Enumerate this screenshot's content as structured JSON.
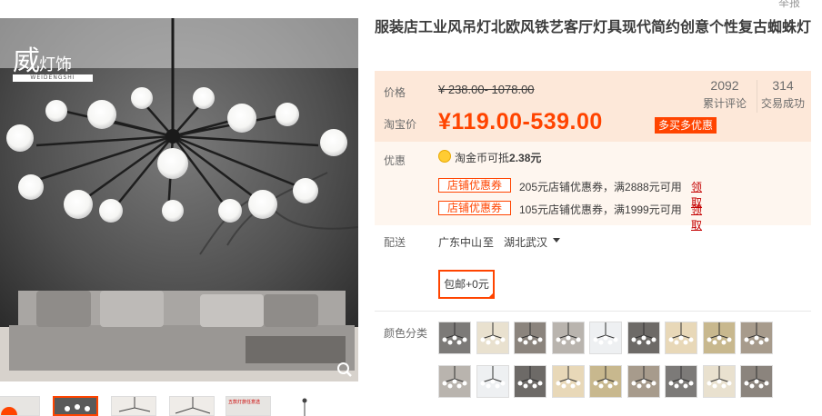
{
  "header": {
    "report_label": "举报"
  },
  "gallery": {
    "logo_main": "威",
    "logo_side": "灯饰",
    "logo_sub": "WEIDENGSHI",
    "zoom_icon": "search-icon",
    "thumb_promo_text": "五款灯旅任意选"
  },
  "product": {
    "title": "服装店工业风吊灯北欧风铁艺客厅灯具现代简约创意个性复古蜘蛛灯"
  },
  "price": {
    "original_label": "价格",
    "original_price": "¥ 238.00- 1078.00",
    "tb_label": "淘宝价",
    "tb_price": "¥119.00-539.00",
    "promo_tag": "多买多优惠",
    "stats": [
      {
        "num": "2092",
        "label": "累计评论"
      },
      {
        "num": "314",
        "label": "交易成功"
      }
    ]
  },
  "discount": {
    "label": "优惠",
    "coin_text_prefix": "淘金币可抵",
    "coin_value": "2.38元",
    "coupons": [
      {
        "tag": "店铺优惠券",
        "desc": "205元店铺优惠券，满2888元可用",
        "action": "领取"
      },
      {
        "tag": "店铺优惠券",
        "desc": "105元店铺优惠券，满1999元可用",
        "action": "领取"
      }
    ]
  },
  "shipping": {
    "label": "配送",
    "from": "广东中山",
    "to_word": "至",
    "destination": "湖北武汉",
    "option": "包邮+0元"
  },
  "sku": {
    "label": "颜色分类",
    "options_count_visible": 18
  },
  "colors": {
    "accent": "#ff4400",
    "price_bg": "#fde8d9",
    "price_bg_light": "#fef6ef"
  }
}
